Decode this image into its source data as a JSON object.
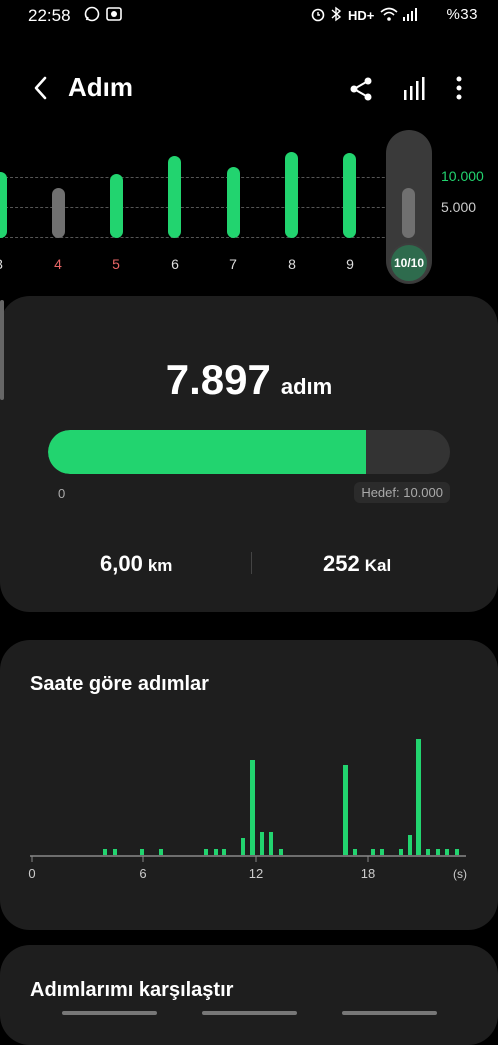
{
  "status_bar": {
    "time": "22:58",
    "left_icons": [
      "whatsapp-icon",
      "camera-icon"
    ],
    "right_text": "HD+",
    "battery": "%33"
  },
  "app_bar": {
    "title": "Adım",
    "icons": [
      "back-icon",
      "share-icon",
      "stats-icon",
      "more-icon"
    ]
  },
  "weekly": {
    "goal_high": "10.000",
    "goal_low": "5.000",
    "day_labels": [
      "3",
      "4",
      "5",
      "6",
      "7",
      "8",
      "9"
    ],
    "selected_label": "10/10",
    "accent": "#22d46f",
    "warn_color": "#e86666"
  },
  "summary": {
    "steps": "7.897",
    "steps_unit": "adım",
    "progress": 0.79,
    "progress_start": "0",
    "goal_text": "Hedef: 10.000",
    "distance": "6,00",
    "distance_unit": "km",
    "calories": "252",
    "calories_unit": "Kal"
  },
  "hourly": {
    "title": "Saate göre adımlar",
    "ticks": [
      "0",
      "6",
      "12",
      "18"
    ],
    "unit": "(s)"
  },
  "compare": {
    "title": "Adımlarımı karşılaştır"
  }
}
